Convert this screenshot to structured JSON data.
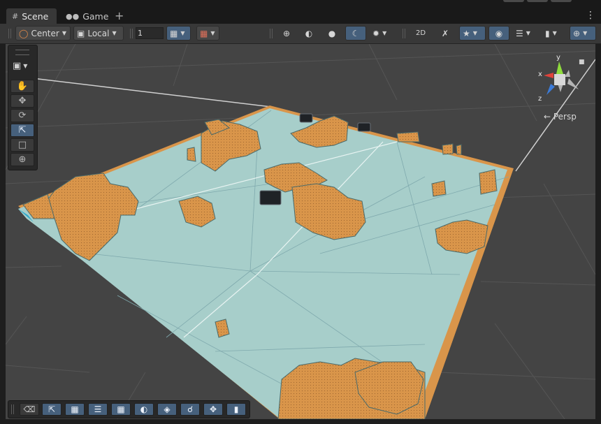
{
  "tabs": [
    {
      "label": "Scene",
      "icon": "grid-icon",
      "active": true
    },
    {
      "label": "Game",
      "icon": "gamepad-icon",
      "active": false
    }
  ],
  "toolbar": {
    "pivot_label": "Center",
    "space_label": "Local",
    "grid_snap_value": "1"
  },
  "viewport": {
    "projection_label": "← Persp",
    "gizmo_axes": {
      "x": "x",
      "y": "y",
      "z": "z"
    },
    "colors": {
      "ground": "#a7ceca",
      "terrain": "#d9954a",
      "background": "#464646",
      "x_axis": "#e0423a",
      "y_axis": "#8fdc3c",
      "z_axis": "#3b7bd8"
    }
  },
  "tools": [
    "hand-tool",
    "move-tool",
    "rotate-tool",
    "scale-tool",
    "rect-tool",
    "transform-tool"
  ],
  "overlay_tools": [
    "eraser",
    "scale",
    "rect",
    "adjust",
    "grid",
    "cycle",
    "layers",
    "search",
    "pivot",
    "camera"
  ]
}
